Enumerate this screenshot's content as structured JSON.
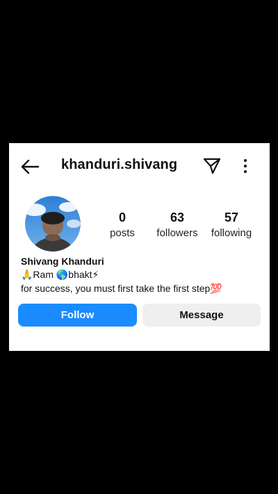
{
  "header": {
    "username": "khanduri.shivang",
    "back_icon": "arrow-left-icon",
    "send_icon": "paper-plane-icon",
    "more_icon": "vertical-dots-icon"
  },
  "profile": {
    "avatar_icon": "profile-photo",
    "display_name": "Shivang Khanduri",
    "bio": [
      "🙏Ram 🌎bhakt⚡",
      "for success, you must first take the first step💯"
    ]
  },
  "stats": {
    "posts": {
      "value": "0",
      "label": "posts"
    },
    "followers": {
      "value": "63",
      "label": "followers"
    },
    "following": {
      "value": "57",
      "label": "following"
    }
  },
  "actions": {
    "follow_label": "Follow",
    "message_label": "Message"
  },
  "colors": {
    "page_background": "#000000",
    "card_background": "#ffffff",
    "follow_button": "#1a8cff",
    "message_button": "#efefef",
    "text": "#111111"
  }
}
